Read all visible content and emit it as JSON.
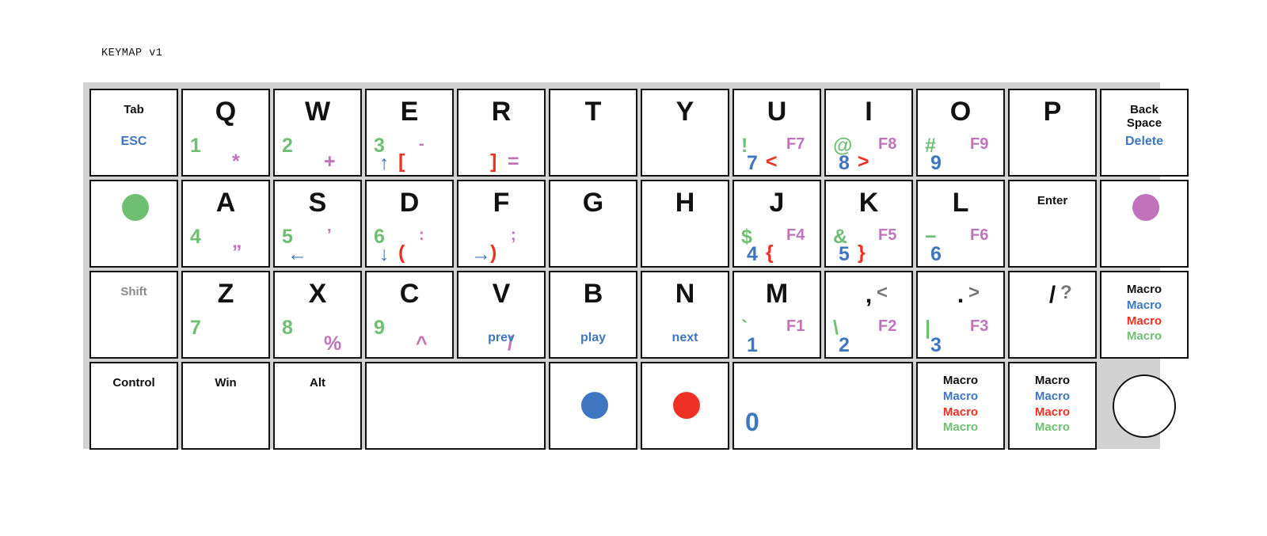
{
  "title": "KEYMAP v1",
  "colors": {
    "board_bg": "#d2d2d2",
    "key_bg": "#ffffff",
    "key_border": "#111111",
    "layer_black": "#111111",
    "layer_blue": "#3f76c0",
    "layer_green": "#6fbf73",
    "layer_purple": "#c072bb",
    "layer_red": "#ee3124",
    "layer_gray": "#767676"
  },
  "rows": [
    {
      "name": "row-1",
      "keys": [
        {
          "id": "tab",
          "type": "word",
          "main": "Tab",
          "sub": "ESC"
        },
        {
          "id": "q",
          "type": "glyph",
          "glyph": "Q",
          "green": "1",
          "purple": "*"
        },
        {
          "id": "w",
          "type": "glyph",
          "glyph": "W",
          "green": "2",
          "purple": "+"
        },
        {
          "id": "e",
          "type": "glyph",
          "glyph": "E",
          "green": "3",
          "purple": "-",
          "blue": "↑",
          "red": "["
        },
        {
          "id": "r",
          "type": "glyph",
          "glyph": "R",
          "purple": "=",
          "red": "]"
        },
        {
          "id": "t",
          "type": "glyph",
          "glyph": "T"
        },
        {
          "id": "y",
          "type": "glyph",
          "glyph": "Y"
        },
        {
          "id": "u",
          "type": "glyph",
          "glyph": "U",
          "green": "!",
          "blue": "7",
          "red": "<",
          "purple": "F7"
        },
        {
          "id": "i",
          "type": "glyph",
          "glyph": "I",
          "green": "@",
          "blue": "8",
          "red": ">",
          "purple": "F8"
        },
        {
          "id": "o",
          "type": "glyph",
          "glyph": "O",
          "green": "#",
          "blue": "9",
          "purple": "F9"
        },
        {
          "id": "p",
          "type": "glyph",
          "glyph": "P"
        },
        {
          "id": "backspace",
          "type": "word",
          "main": "Back\nSpace",
          "sub": "Delete"
        }
      ]
    },
    {
      "name": "row-2",
      "keys": [
        {
          "id": "layer-green-dot",
          "type": "dot",
          "dot": "green"
        },
        {
          "id": "a",
          "type": "glyph",
          "glyph": "A",
          "green": "4",
          "purple": "”"
        },
        {
          "id": "s",
          "type": "glyph",
          "glyph": "S",
          "green": "5",
          "purple": "’",
          "blue": "←"
        },
        {
          "id": "d",
          "type": "glyph",
          "glyph": "D",
          "green": "6",
          "purple": ":",
          "blue": "↓",
          "red": "("
        },
        {
          "id": "f",
          "type": "glyph",
          "glyph": "F",
          "purple": ";",
          "blue": "→",
          "red": ")"
        },
        {
          "id": "g",
          "type": "glyph",
          "glyph": "G"
        },
        {
          "id": "h",
          "type": "glyph",
          "glyph": "H"
        },
        {
          "id": "j",
          "type": "glyph",
          "glyph": "J",
          "green": "$",
          "blue": "4",
          "red": "{",
          "purple": "F4"
        },
        {
          "id": "k",
          "type": "glyph",
          "glyph": "K",
          "green": "&",
          "blue": "5",
          "red": "}",
          "purple": "F5"
        },
        {
          "id": "l",
          "type": "glyph",
          "glyph": "L",
          "green": "−",
          "blue": "6",
          "purple": "F6"
        },
        {
          "id": "enter",
          "type": "word",
          "main": "Enter"
        },
        {
          "id": "layer-purple-dot",
          "type": "dot",
          "dot": "purple"
        }
      ]
    },
    {
      "name": "row-3",
      "keys": [
        {
          "id": "shift",
          "type": "word",
          "main": "Shift",
          "main_gray": true
        },
        {
          "id": "z",
          "type": "glyph",
          "glyph": "Z",
          "green": "7"
        },
        {
          "id": "x",
          "type": "glyph",
          "glyph": "X",
          "green": "8",
          "purple": "%"
        },
        {
          "id": "c",
          "type": "glyph",
          "glyph": "C",
          "green": "9",
          "purple": "^"
        },
        {
          "id": "v",
          "type": "glyph",
          "glyph": "V",
          "purple": "/",
          "sub": "prev"
        },
        {
          "id": "b",
          "type": "glyph",
          "glyph": "B",
          "sub": "play"
        },
        {
          "id": "n",
          "type": "glyph",
          "glyph": "N",
          "sub": "next"
        },
        {
          "id": "m",
          "type": "glyph",
          "glyph": "M",
          "green": "`",
          "blue": "1",
          "purple": "F1"
        },
        {
          "id": "comma",
          "type": "glyph",
          "glyph": ",",
          "green": "\\",
          "blue": "2",
          "gray": "<",
          "purple": "F2"
        },
        {
          "id": "period",
          "type": "glyph",
          "glyph": ".",
          "green": "|",
          "blue": "3",
          "gray": ">",
          "purple": "F3"
        },
        {
          "id": "slash",
          "type": "glyph",
          "glyph": "/",
          "gray": "?"
        },
        {
          "id": "macro-r3",
          "type": "macro",
          "macros": [
            "Macro",
            "Macro",
            "Macro",
            "Macro"
          ]
        }
      ]
    },
    {
      "name": "row-4",
      "keys": [
        {
          "id": "control",
          "type": "word",
          "main": "Control"
        },
        {
          "id": "win",
          "type": "word",
          "main": "Win"
        },
        {
          "id": "alt",
          "type": "word",
          "main": "Alt"
        },
        {
          "id": "space",
          "type": "blank",
          "wide": true
        },
        {
          "id": "layer-blue-dot",
          "type": "dot",
          "dot": "blue"
        },
        {
          "id": "layer-red-dot",
          "type": "dot",
          "dot": "red"
        },
        {
          "id": "zero",
          "type": "blank",
          "wide": true,
          "blue_big": "0"
        },
        {
          "id": "macro-b1",
          "type": "macro",
          "macros": [
            "Macro",
            "Macro",
            "Macro",
            "Macro"
          ]
        },
        {
          "id": "macro-b2",
          "type": "macro",
          "macros": [
            "Macro",
            "Macro",
            "Macro",
            "Macro"
          ]
        },
        {
          "id": "encoder",
          "type": "encoder"
        }
      ]
    }
  ]
}
